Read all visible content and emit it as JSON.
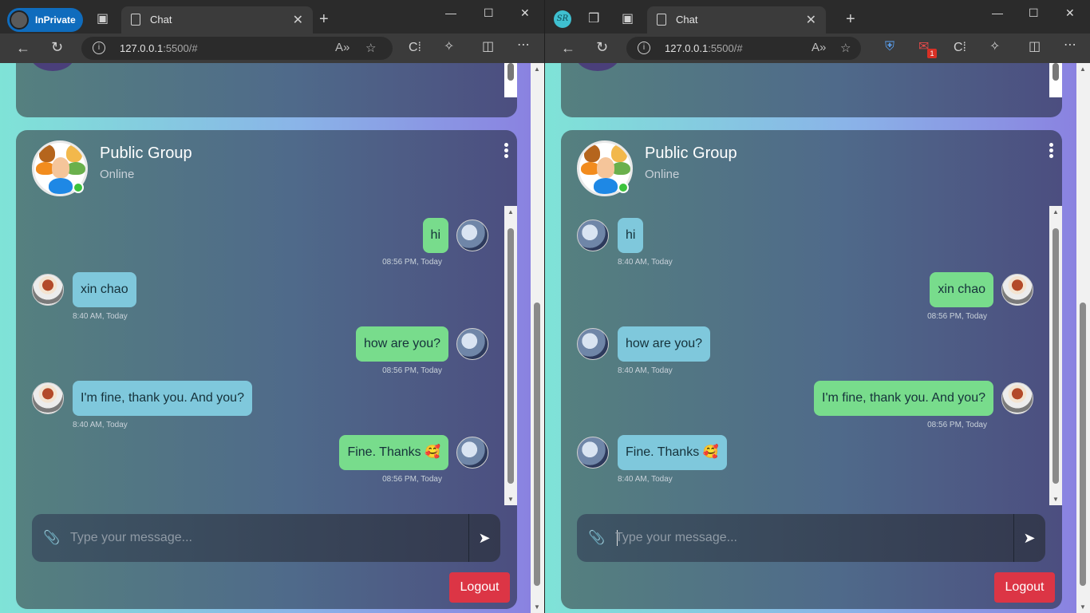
{
  "left_window": {
    "inprivate_label": "InPrivate",
    "tab_title": "Chat",
    "url_host": "127.0.0.1",
    "url_rest": ":5500/#"
  },
  "right_window": {
    "profile_initials": "SR",
    "tab_title": "Chat",
    "url_host": "127.0.0.1",
    "url_rest": ":5500/#",
    "mail_badge": "1"
  },
  "chat": {
    "group_name": "Public Group",
    "status": "Online",
    "placeholder": "Type your message...",
    "logout_label": "Logout"
  },
  "left_messages": [
    {
      "text": "hi",
      "time": "08:56 PM, Today",
      "side": "right",
      "color": "green",
      "avatar": "anime"
    },
    {
      "text": "xin chao",
      "time": "8:40 AM, Today",
      "side": "left",
      "color": "blue",
      "avatar": "boy"
    },
    {
      "text": "how are you?",
      "time": "08:56 PM, Today",
      "side": "right",
      "color": "green",
      "avatar": "anime"
    },
    {
      "text": "I'm fine, thank you. And you?",
      "time": "8:40 AM, Today",
      "side": "left",
      "color": "blue",
      "avatar": "boy"
    },
    {
      "text": "Fine. Thanks 🥰",
      "time": "08:56 PM, Today",
      "side": "right",
      "color": "green",
      "avatar": "anime"
    }
  ],
  "right_messages": [
    {
      "text": "hi",
      "time": "8:40 AM, Today",
      "side": "left",
      "color": "blue",
      "avatar": "anime"
    },
    {
      "text": "xin chao",
      "time": "08:56 PM, Today",
      "side": "right",
      "color": "green",
      "avatar": "boy"
    },
    {
      "text": "how are you?",
      "time": "8:40 AM, Today",
      "side": "left",
      "color": "blue",
      "avatar": "anime"
    },
    {
      "text": "I'm fine, thank you. And you?",
      "time": "08:56 PM, Today",
      "side": "right",
      "color": "green",
      "avatar": "boy"
    },
    {
      "text": "Fine. Thanks 🥰",
      "time": "8:40 AM, Today",
      "side": "left",
      "color": "blue",
      "avatar": "anime"
    }
  ],
  "colors": {
    "bubble_green": "#78dc8c",
    "bubble_blue": "#7fc8dc",
    "logout_red": "#dc3545",
    "online_green": "#3cc33c"
  }
}
